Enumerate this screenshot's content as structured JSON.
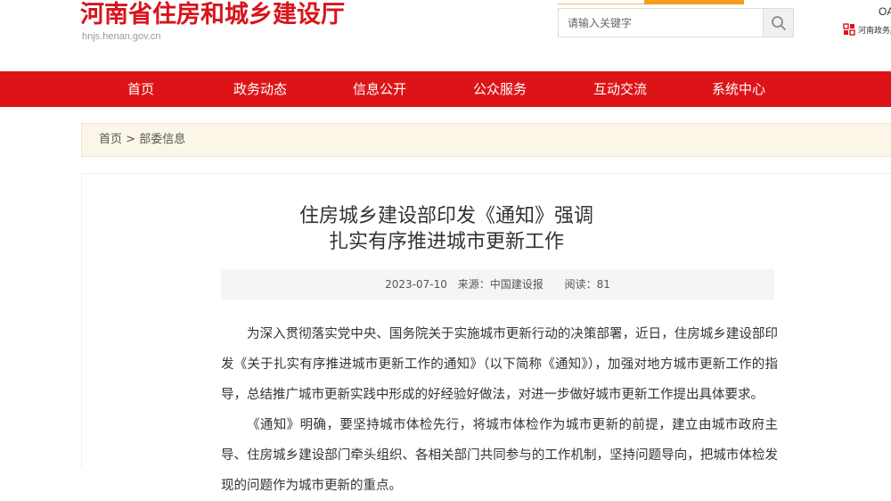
{
  "header": {
    "site_title": "河南省住房和城乡建设厅",
    "site_domain": "hnjs.henan.gov.cn",
    "search_placeholder": "请输入关键字",
    "oa_label": "OA",
    "gov_logo_name": "河南政务服"
  },
  "nav": {
    "items": [
      "首页",
      "政务动态",
      "信息公开",
      "公众服务",
      "互动交流",
      "系统中心"
    ]
  },
  "breadcrumb": {
    "home": "首页",
    "separator": " > ",
    "current": "部委信息"
  },
  "article": {
    "title_line1": "住房城乡建设部印发《通知》强调",
    "title_line2": "扎实有序推进城市更新工作",
    "date": "2023-07-10",
    "source": "来源：中国建设报",
    "reads": "阅读：81",
    "paragraphs": [
      "为深入贯彻落实党中央、国务院关于实施城市更新行动的决策部署，近日，住房城乡建设部印发《关于扎实有序推进城市更新工作的通知》（以下简称《通知》），加强对地方城市更新工作的指导，总结推广城市更新实践中形成的好经验好做法，对进一步做好城市更新工作提出具体要求。",
      "《通知》明确，要坚持城市体检先行，将城市体检作为城市更新的前提，建立由城市政府主导、住房城乡建设部门牵头组织、各相关部门共同参与的工作机制，坚持问题导向，把城市体检发现的问题作为城市更新的重点。"
    ]
  },
  "colors": {
    "brand_red": "#d8141b",
    "nav_red": "#dd1417",
    "accent_orange": "#f39c1f",
    "breadcrumb_bg": "#fbf6e8"
  }
}
